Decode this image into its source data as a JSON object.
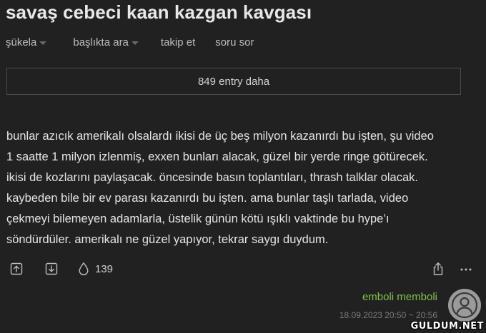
{
  "topic": {
    "title": "savaş cebeci kaan kazgan kavgası"
  },
  "nav": {
    "sort_label": "şükela",
    "search_label": "başlıkta ara",
    "follow_label": "takip et",
    "ask_label": "soru sor"
  },
  "more_entries": {
    "label": "849 entry daha"
  },
  "entry": {
    "text": "bunlar azıcık amerikalı olsalardı ikisi de üç beş milyon kazanırdı bu işten, şu video\n1 saatte 1 milyon izlenmiş, exxen bunları alacak, güzel bir yerde ringe götürecek.\nikisi de kozlarını paylaşacak. öncesinde basın toplantıları, thrash talklar olacak.\nkaybeden bile bir ev parası kazanırdı bu işten. ama bunlar taşlı tarlada, video\nçekmeyi bilemeyen adamlarla, üstelik günün kötü ışıklı vaktinde bu hype’ı\nsöndürdüler. amerikalı ne güzel yapıyor, tekrar saygı duydum.",
    "favorite_count": "139",
    "author": "emboli memboli",
    "date": "18.09.2023 20:50 ~ 20:56",
    "icons": {
      "upvote": "arrow-up-icon",
      "downvote": "arrow-down-icon",
      "favorite": "drop-icon",
      "share": "share-icon",
      "more": "more-dots-icon",
      "avatar": "user-avatar-icon"
    }
  },
  "watermark": {
    "text": "GULDUM.NET"
  },
  "colors": {
    "background": "#212121",
    "text": "#e6e6e6",
    "author": "#81c14b",
    "muted": "#7a7a7a"
  }
}
